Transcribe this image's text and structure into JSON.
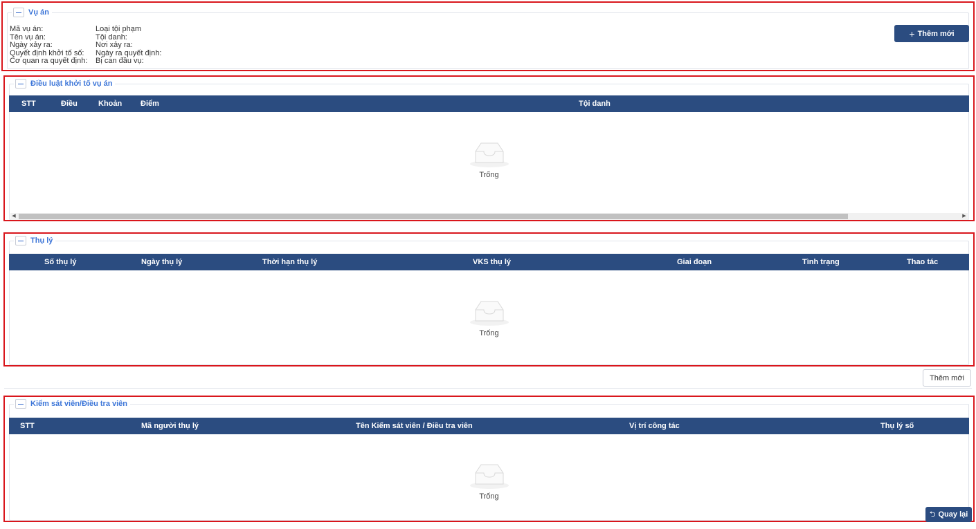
{
  "case": {
    "title": "Vụ án",
    "fields_left": [
      "Mã vụ án:",
      "Tên vụ án:",
      "Ngày xảy ra:",
      "Quyết định khởi tố số:",
      "Cơ quan ra quyết định:"
    ],
    "fields_right": [
      "Loại tội phạm",
      "Tội danh:",
      "Nơi xảy ra:",
      "Ngày ra quyết định:",
      "Bị can đầu vụ:"
    ],
    "add_button": "Thêm mới"
  },
  "law": {
    "title": "Điều luật khởi tố vụ án",
    "columns": [
      "STT",
      "Điều",
      "Khoản",
      "Điểm",
      "Tội danh"
    ],
    "empty_text": "Trống"
  },
  "handling": {
    "title": "Thụ lý",
    "columns": [
      "Số thụ lý",
      "Ngày thụ lý",
      "Thời hạn thụ lý",
      "VKS thụ lý",
      "Giai đoạn",
      "Tình trạng",
      "Thao tác"
    ],
    "empty_text": "Trống",
    "add_button": "Thêm mới"
  },
  "officers": {
    "title": "Kiểm sát viên/Điều tra viên",
    "columns": [
      "STT",
      "Mã người thụ lý",
      "Tên Kiểm sát viên / Điều tra viên",
      "Vị trí công tác",
      "Thụ lý số"
    ],
    "empty_text": "Trống"
  },
  "back_button": "Quay lại",
  "colors": {
    "header": "#2b4c80",
    "accent": "#3d76d8",
    "highlight": "#d9161c"
  }
}
